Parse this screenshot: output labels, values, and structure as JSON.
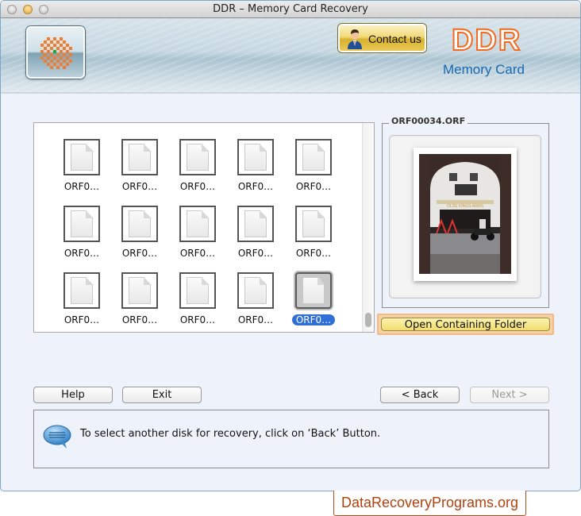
{
  "window": {
    "title": "DDR – Memory Card Recovery"
  },
  "header": {
    "contact_label": "Contact us",
    "brand_title": "DDR",
    "brand_subtitle": "Memory Card",
    "brand_title_color": "#f26b21",
    "brand_subtitle_color": "#1769b3"
  },
  "file_browser": {
    "files": [
      {
        "label": "ORF0…",
        "selected": false
      },
      {
        "label": "ORF0…",
        "selected": false
      },
      {
        "label": "ORF0…",
        "selected": false
      },
      {
        "label": "ORF0…",
        "selected": false
      },
      {
        "label": "ORF0…",
        "selected": false
      },
      {
        "label": "ORF0…",
        "selected": false
      },
      {
        "label": "ORF0…",
        "selected": false
      },
      {
        "label": "ORF0…",
        "selected": false
      },
      {
        "label": "ORF0…",
        "selected": false
      },
      {
        "label": "ORF0…",
        "selected": false
      },
      {
        "label": "ORF0…",
        "selected": false
      },
      {
        "label": "ORF0…",
        "selected": false
      },
      {
        "label": "ORF0…",
        "selected": false
      },
      {
        "label": "ORF0…",
        "selected": false
      },
      {
        "label": "ORF0…",
        "selected": true
      }
    ]
  },
  "preview": {
    "filename": "ORF00034.ORF",
    "open_folder_label": "Open Containing Folder"
  },
  "buttons": {
    "help": "Help",
    "exit": "Exit",
    "back": "< Back",
    "next": "Next >"
  },
  "status": {
    "message": "To select another disk for recovery, click on ‘Back’ Button."
  },
  "footer": {
    "watermark": "DataRecoveryPrograms.org"
  }
}
